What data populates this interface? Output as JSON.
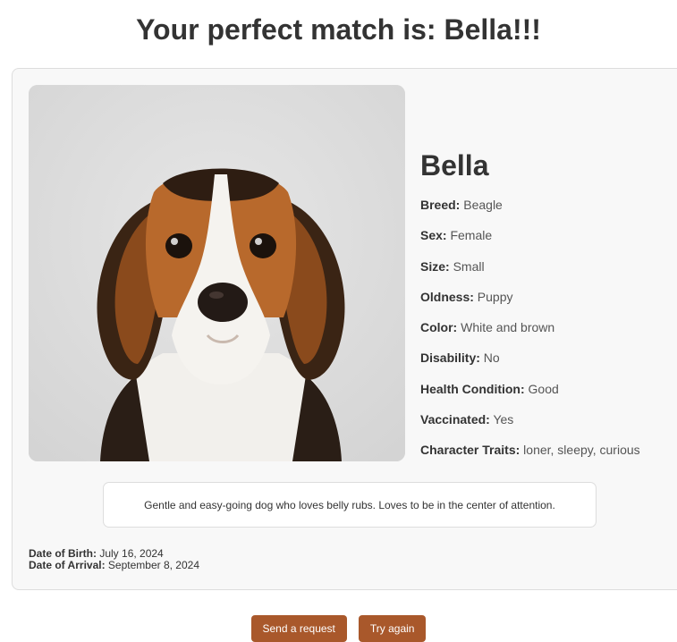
{
  "header": {
    "title": "Your perfect match is: Bella!!!"
  },
  "pet": {
    "name": "Bella",
    "photo_icon": "beagle-puppy-photo",
    "attributes": [
      {
        "label": "Breed:",
        "value": "Beagle"
      },
      {
        "label": "Sex:",
        "value": "Female"
      },
      {
        "label": "Size:",
        "value": "Small"
      },
      {
        "label": "Oldness:",
        "value": "Puppy"
      },
      {
        "label": "Color:",
        "value": "White and brown"
      },
      {
        "label": "Disability:",
        "value": "No"
      },
      {
        "label": "Health Condition:",
        "value": "Good"
      },
      {
        "label": "Vaccinated:",
        "value": "Yes"
      },
      {
        "label": "Character Traits:",
        "value": "loner, sleepy, curious"
      }
    ],
    "description": "Gentle and easy-going dog who loves belly rubs. Loves to be in the center of attention.",
    "dates": {
      "birth_label": "Date of Birth:",
      "birth_value": "July 16, 2024",
      "arrival_label": "Date of Arrival:",
      "arrival_value": "September 8, 2024"
    }
  },
  "actions": {
    "send_request_label": "Send a request",
    "try_again_label": "Try again"
  },
  "colors": {
    "button_bg": "#a9582b",
    "card_bg": "#f8f8f8",
    "photo_bg": "#dddddd"
  }
}
